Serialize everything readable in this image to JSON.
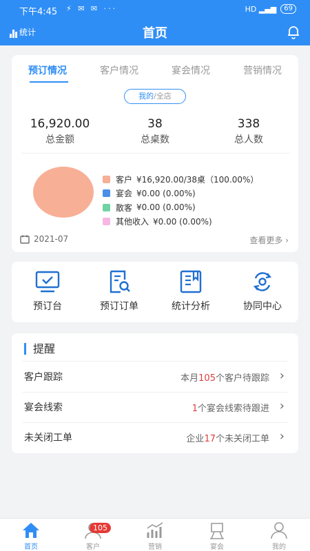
{
  "status_bar": {
    "time": "下午4:45",
    "left_icons": "⚡ ✉ ✉ ···",
    "signal": "HD ▂▄▆",
    "battery": "69"
  },
  "header": {
    "stats_label": "统计",
    "title": "首页"
  },
  "tabs": [
    "预订情况",
    "客户情况",
    "宴会情况",
    "营销情况"
  ],
  "scope_toggle": {
    "selected": "我的",
    "separator": "/",
    "other": "全店"
  },
  "stats": [
    {
      "value": "16,920.00",
      "label": "总金额"
    },
    {
      "value": "38",
      "label": "总桌数"
    },
    {
      "value": "338",
      "label": "总人数"
    }
  ],
  "chart_data": {
    "type": "pie",
    "categories": [
      "客户",
      "宴会",
      "散客",
      "其他收入"
    ],
    "values": [
      16920.0,
      0.0,
      0.0,
      0.0
    ],
    "colors": [
      "#f7af96",
      "#4a8fe8",
      "#6fd3a3",
      "#f7b6e3"
    ],
    "legend_text": [
      "¥16,920.00/38桌（100.00%）",
      "¥0.00 (0.00%)",
      "¥0.00 (0.00%)",
      "¥0.00 (0.00%)"
    ]
  },
  "date": "2021-07",
  "more_label": "查看更多",
  "quick_actions": [
    {
      "label": "预订台",
      "icon": "monitor-check-icon"
    },
    {
      "label": "预订订单",
      "icon": "document-search-icon"
    },
    {
      "label": "统计分析",
      "icon": "report-book-icon"
    },
    {
      "label": "协同中心",
      "icon": "sync-gear-icon"
    }
  ],
  "reminders": {
    "title": "提醒",
    "items": [
      {
        "label": "客户跟踪",
        "prefix": "本月",
        "count": "105",
        "suffix": "个客户待跟踪"
      },
      {
        "label": "宴会线索",
        "prefix": "",
        "count": "1",
        "suffix": "个宴会线索待跟进"
      },
      {
        "label": "未关闭工单",
        "prefix": "企业",
        "count": "17",
        "suffix": "个未关闭工单"
      }
    ]
  },
  "bottom_nav": {
    "items": [
      {
        "label": "首页",
        "icon": "home-icon",
        "active": true
      },
      {
        "label": "客户",
        "icon": "customer-icon",
        "active": false
      },
      {
        "label": "营销",
        "icon": "marketing-icon",
        "active": false
      },
      {
        "label": "宴会",
        "icon": "banquet-icon",
        "active": false
      },
      {
        "label": "我的",
        "icon": "profile-icon",
        "active": false
      }
    ],
    "customer_badge": "105"
  },
  "colors": {
    "primary": "#2f8ef5",
    "highlight_number": "#e03c3c",
    "badge": "#e53935"
  }
}
